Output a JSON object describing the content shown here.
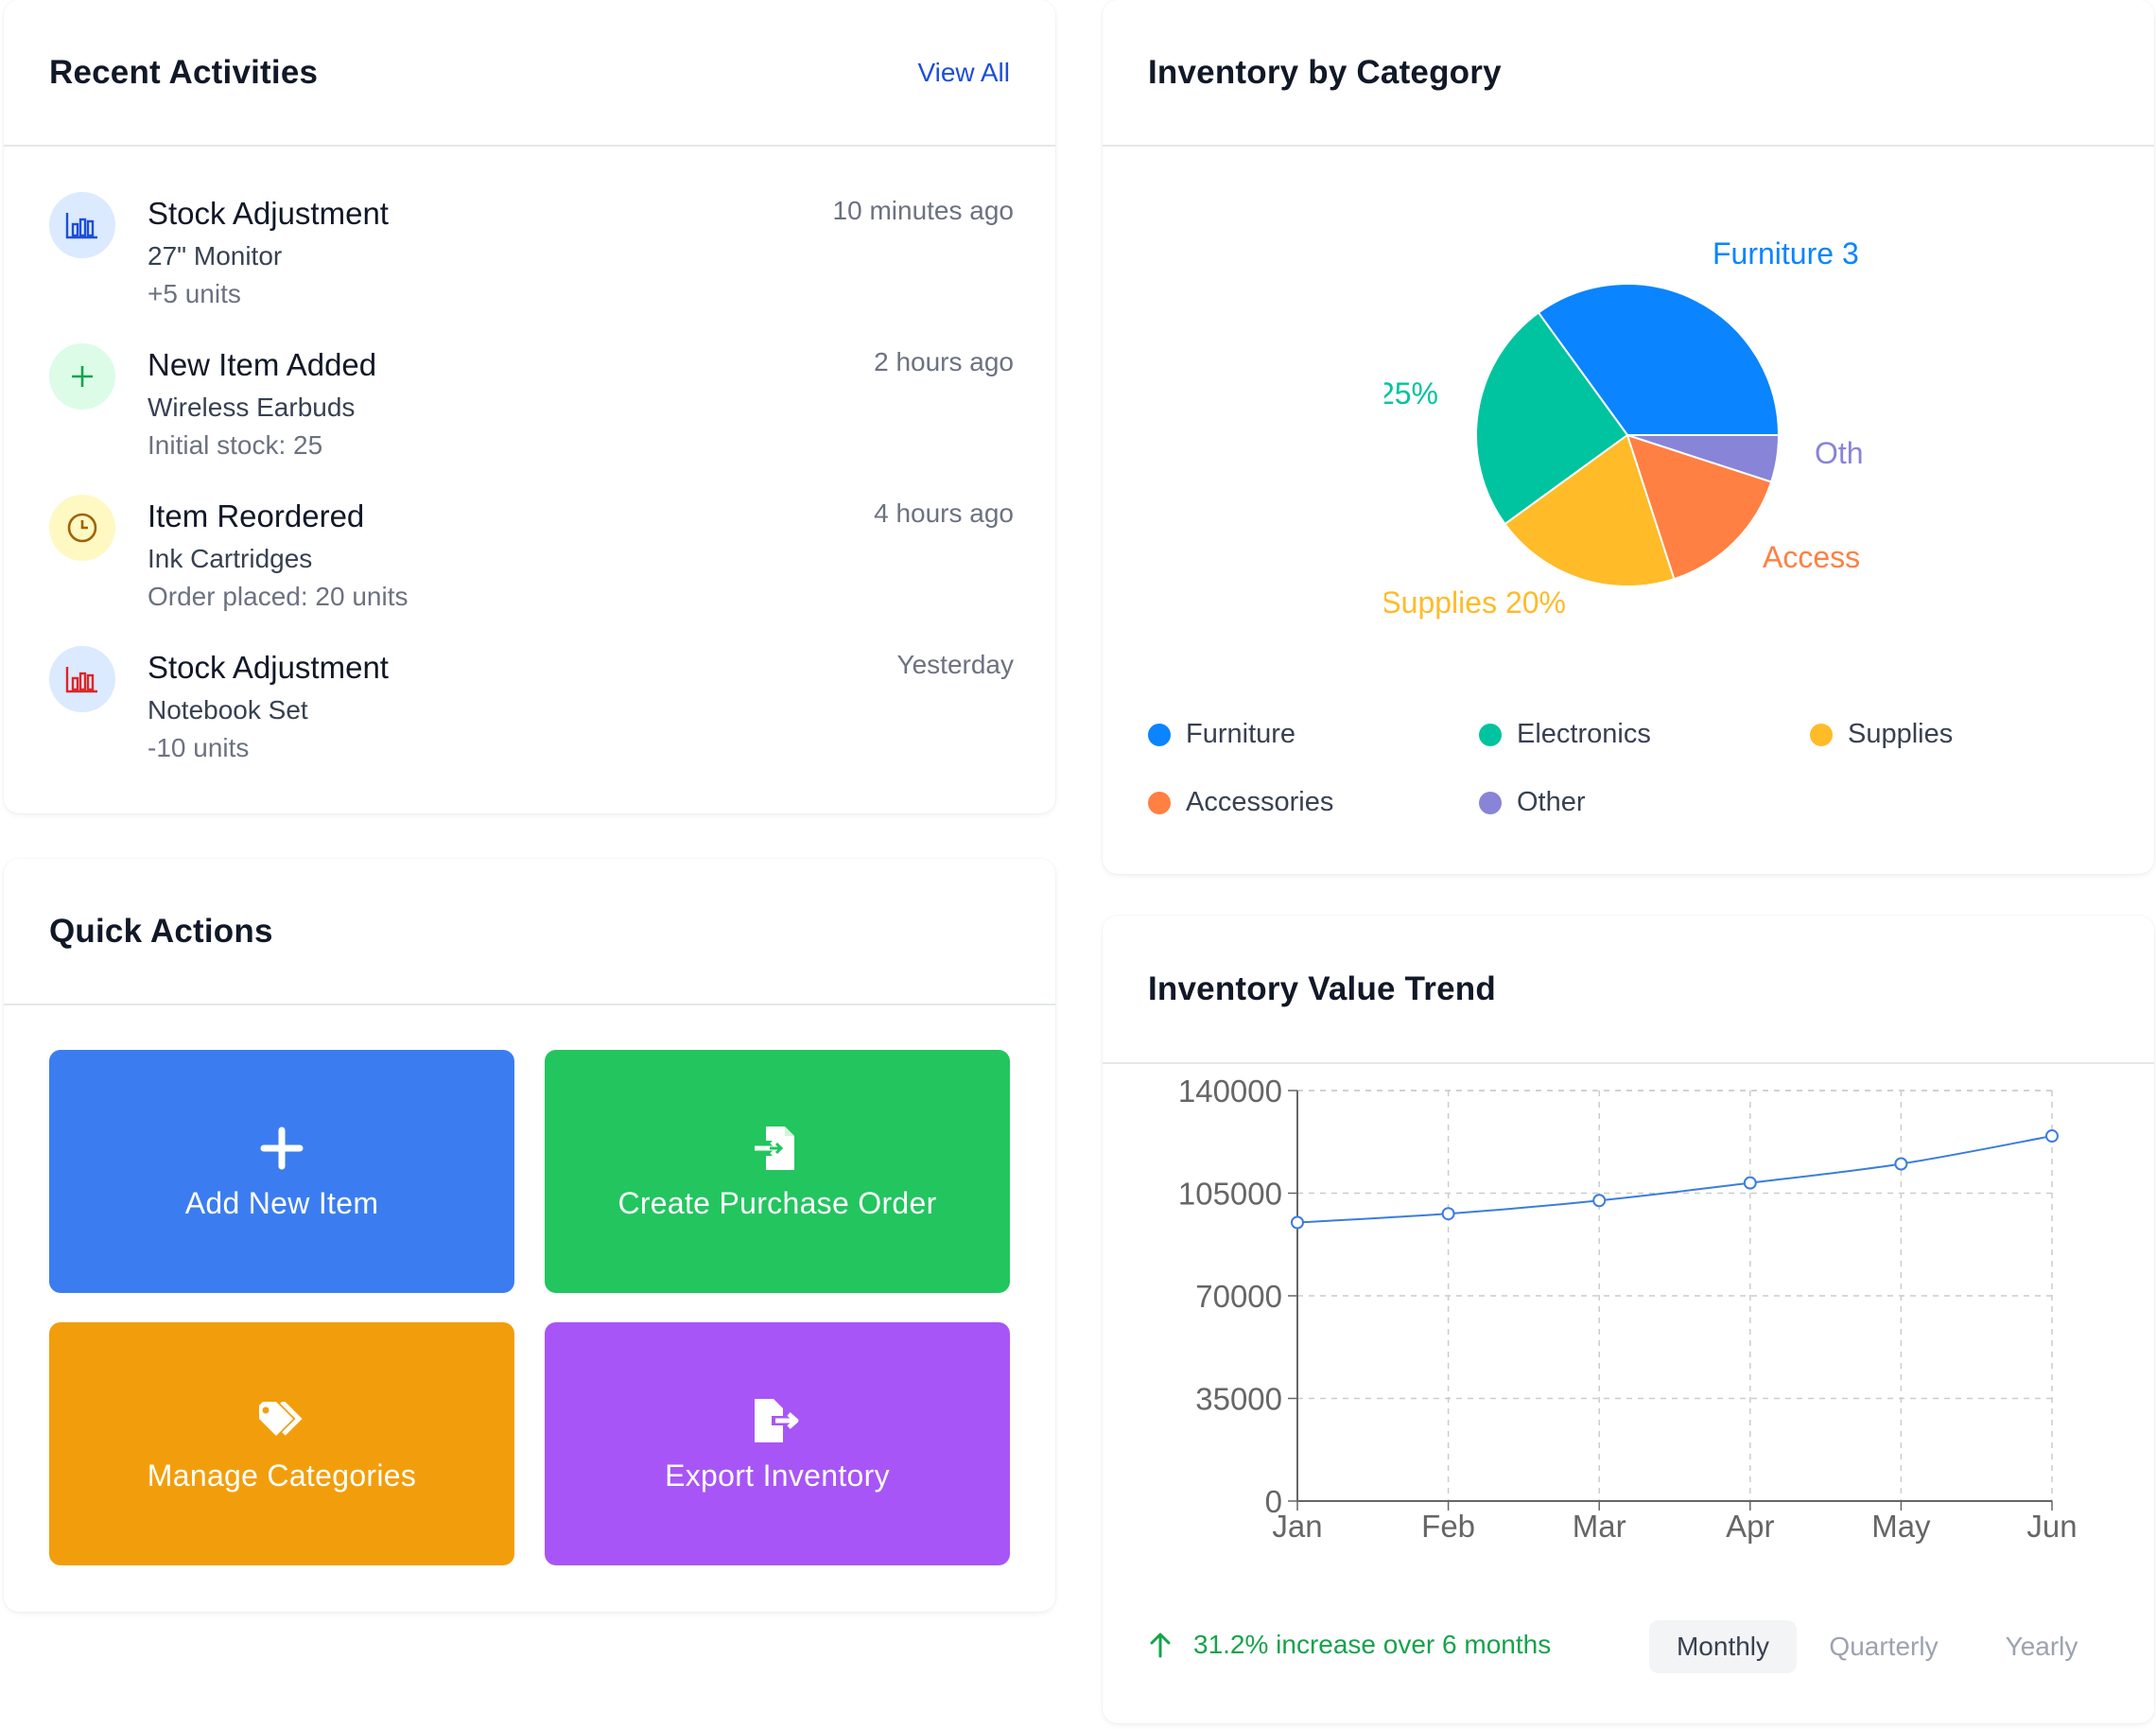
{
  "recent": {
    "title": "Recent Activities",
    "view_all": "View All",
    "items": [
      {
        "title": "Stock Adjustment",
        "subtitle": "27\" Monitor",
        "detail": "+5 units",
        "time": "10 minutes ago",
        "icon": "bar-chart-icon",
        "icon_bg": "#dbeafe",
        "icon_color": "#1d4ed8"
      },
      {
        "title": "New Item Added",
        "subtitle": "Wireless Earbuds",
        "detail": "Initial stock: 25",
        "time": "2 hours ago",
        "icon": "plus-icon",
        "icon_bg": "#dcfce7",
        "icon_color": "#16a34a"
      },
      {
        "title": "Item Reordered",
        "subtitle": "Ink Cartridges",
        "detail": "Order placed: 20 units",
        "time": "4 hours ago",
        "icon": "clock-icon",
        "icon_bg": "#fef9c3",
        "icon_color": "#a16207"
      },
      {
        "title": "Stock Adjustment",
        "subtitle": "Notebook Set",
        "detail": "-10 units",
        "time": "Yesterday",
        "icon": "bar-chart-icon",
        "icon_bg": "#dbeafe",
        "icon_color": "#dc2626"
      }
    ]
  },
  "quick": {
    "title": "Quick Actions",
    "actions": [
      {
        "label": "Add New Item",
        "icon": "plus-icon",
        "color": "#3b7df0"
      },
      {
        "label": "Create Purchase Order",
        "icon": "file-import-icon",
        "color": "#22c55e"
      },
      {
        "label": "Manage Categories",
        "icon": "tags-icon",
        "color": "#f29e0c"
      },
      {
        "label": "Export Inventory",
        "icon": "file-export-icon",
        "color": "#a855f7"
      }
    ]
  },
  "pie_card": {
    "title": "Inventory by Category",
    "slice_labels": {
      "furniture": "Furniture 3",
      "electronics": "25%",
      "supplies": "Supplies 20%",
      "accessories": "Access",
      "other": "Oth"
    },
    "legend": [
      {
        "name": "Furniture",
        "color": "#0a84ff"
      },
      {
        "name": "Electronics",
        "color": "#00c49f"
      },
      {
        "name": "Supplies",
        "color": "#ffbb28"
      },
      {
        "name": "Accessories",
        "color": "#ff8042"
      },
      {
        "name": "Other",
        "color": "#8884d8"
      }
    ]
  },
  "trend_card": {
    "title": "Inventory Value Trend",
    "growth_text": "31.2% increase over 6 months",
    "periods": [
      "Monthly",
      "Quarterly",
      "Yearly"
    ],
    "active_period": "Monthly"
  },
  "chart_data": [
    {
      "type": "pie",
      "title": "Inventory by Category",
      "categories": [
        "Furniture",
        "Electronics",
        "Supplies",
        "Accessories",
        "Other"
      ],
      "values": [
        35,
        25,
        20,
        15,
        5
      ],
      "colors": [
        "#0a84ff",
        "#00c49f",
        "#ffbb28",
        "#ff8042",
        "#8884d8"
      ],
      "legend": "bottom"
    },
    {
      "type": "line",
      "title": "Inventory Value Trend",
      "categories": [
        "Jan",
        "Feb",
        "Mar",
        "Apr",
        "May",
        "Jun"
      ],
      "values": [
        95000,
        98000,
        102500,
        108500,
        115000,
        124500
      ],
      "y_ticks": [
        "0",
        "35000",
        "70000",
        "105000",
        "140000"
      ],
      "ylim": [
        0,
        140000
      ],
      "grid": true,
      "color": "#3b7ddd"
    }
  ]
}
